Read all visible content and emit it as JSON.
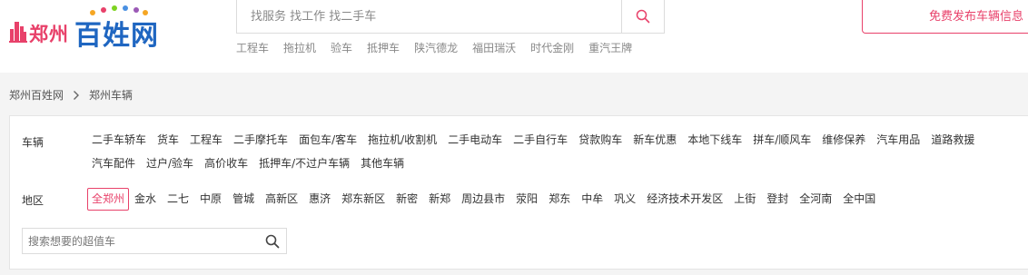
{
  "header": {
    "logo": {
      "city": "郑州",
      "brand": "百姓网"
    },
    "search": {
      "placeholder": "找服务 找工作 找二手车"
    },
    "hot_links": [
      "工程车",
      "拖拉机",
      "验车",
      "抵押车",
      "陕汽德龙",
      "福田瑞沃",
      "时代金刚",
      "重汽王牌"
    ],
    "post_button": "免费发布车辆信息"
  },
  "breadcrumb": [
    "郑州百姓网",
    "郑州车辆"
  ],
  "filters": {
    "category": {
      "label": "车辆",
      "items": [
        "二手车轿车",
        "货车",
        "工程车",
        "二手摩托车",
        "面包车/客车",
        "拖拉机/收割机",
        "二手电动车",
        "二手自行车",
        "贷款购车",
        "新车优惠",
        "本地下线车",
        "拼车/顺风车",
        "维修保养",
        "汽车用品",
        "道路救援",
        "汽车配件",
        "过户/验车",
        "高价收车",
        "抵押车/不过户车辆",
        "其他车辆"
      ]
    },
    "area": {
      "label": "地区",
      "items": [
        "全郑州",
        "金水",
        "二七",
        "中原",
        "管城",
        "高新区",
        "惠济",
        "郑东新区",
        "新密",
        "新郑",
        "周边县市",
        "荥阳",
        "郑东",
        "中牟",
        "巩义",
        "经济技术开发区",
        "上街",
        "登封",
        "全河南",
        "全中国"
      ],
      "selected": "全郑州"
    },
    "keyword": {
      "placeholder": "搜索想要的超值车"
    }
  },
  "colors": {
    "accent": "#e8416a",
    "brand_blue": "#1f66c1"
  }
}
